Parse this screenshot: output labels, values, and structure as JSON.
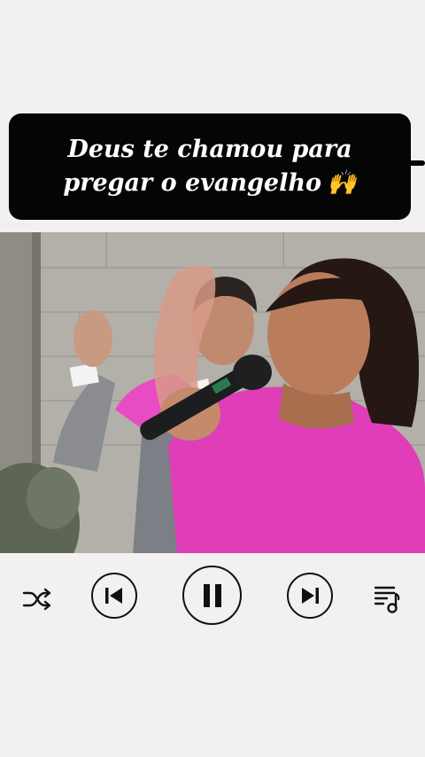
{
  "caption": {
    "line1": "Deus te chamou para",
    "line2": "pregar o evangelho",
    "emoji": "🙌"
  },
  "video": {
    "description_icon": "video-frame"
  },
  "player": {
    "state": "playing",
    "icons": [
      "shuffle-icon",
      "previous-icon",
      "pause-icon",
      "next-icon",
      "playlist-icon"
    ]
  },
  "colors": {
    "background": "#f2f1ef",
    "caption_bg": "#050505",
    "caption_text": "#ffffff",
    "controls": "#111111",
    "shirt": "#e03db8"
  }
}
